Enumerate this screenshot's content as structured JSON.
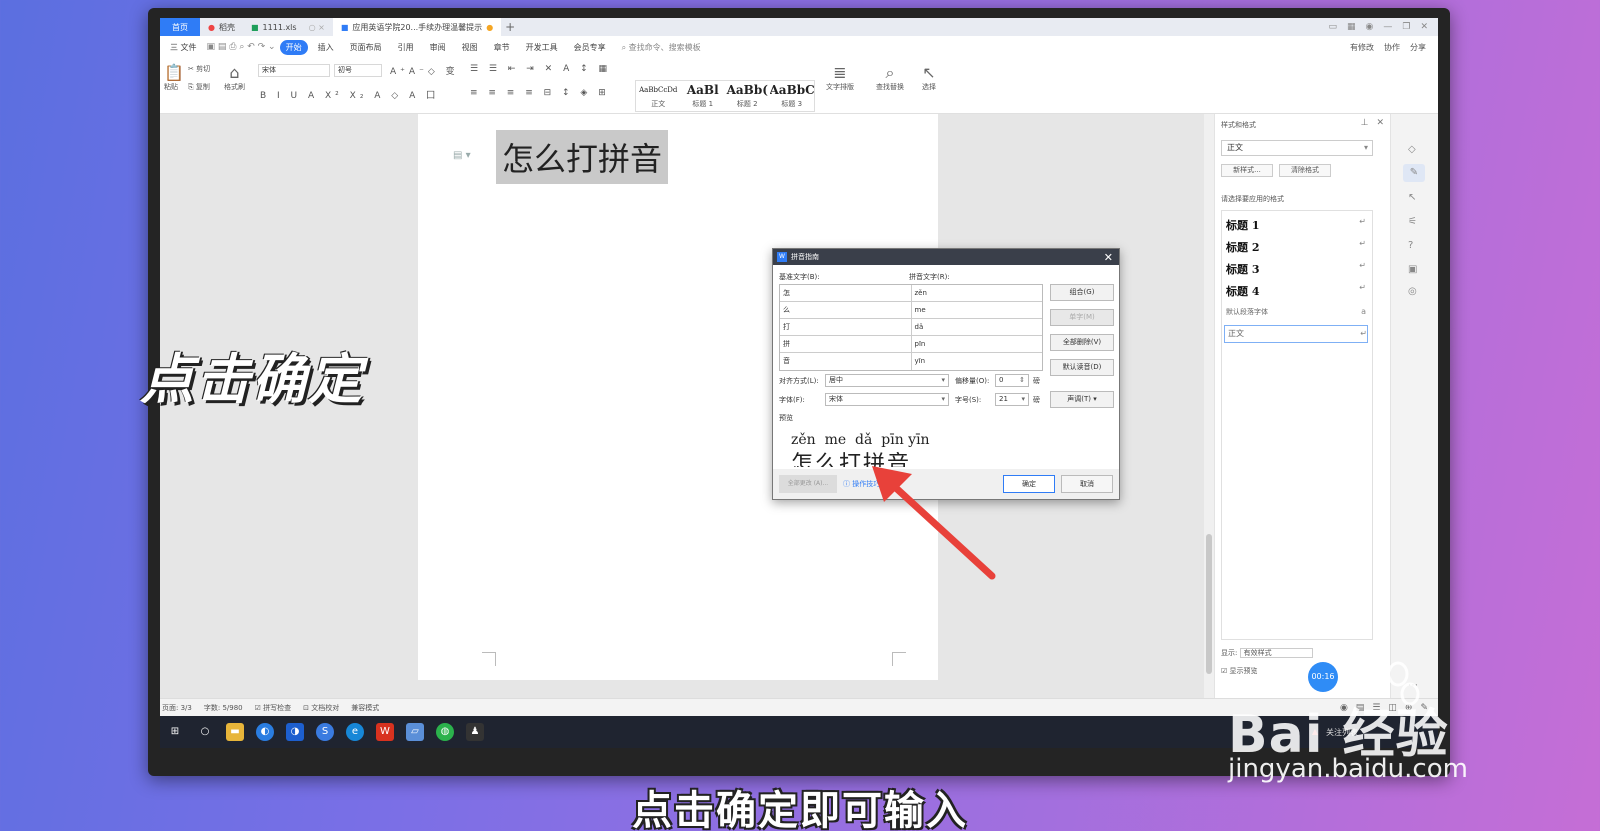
{
  "tabs": [
    {
      "label": "首页",
      "kind": "home"
    },
    {
      "label": "稻壳",
      "kind": "normal"
    },
    {
      "label": "1111.xls",
      "kind": "normal"
    },
    {
      "label": "应用英语学院20...手续办理温馨提示",
      "kind": "active"
    }
  ],
  "tab_plus": "+",
  "menu": {
    "file": "三 文件",
    "items": [
      "开始",
      "插入",
      "页面布局",
      "引用",
      "审阅",
      "视图",
      "章节",
      "开发工具",
      "会员专享"
    ],
    "active": "开始",
    "search": "查找命令、搜索模板",
    "right": [
      "有修改",
      "协作",
      "分享"
    ]
  },
  "ribbon": {
    "paste": "粘贴",
    "cut": "剪切",
    "copy": "复制",
    "format_painter": "格式刷",
    "font_name": "宋体",
    "font_size": "初号",
    "styles": [
      {
        "sample": "AaBbCcDd",
        "label": "正文"
      },
      {
        "sample": "AaBl",
        "label": "标题 1"
      },
      {
        "sample": "AaBb(",
        "label": "标题 2"
      },
      {
        "sample": "AaBbC",
        "label": "标题 3"
      }
    ],
    "text_layout": "文字排版",
    "find_replace": "查找替换",
    "select": "选择"
  },
  "document": {
    "heading": "怎么打拼音"
  },
  "dialog": {
    "title": "拼音指南",
    "col_base": "基准文字(B):",
    "col_pinyin": "拼音文字(R):",
    "rows": [
      {
        "base": "怎",
        "pinyin": "zěn"
      },
      {
        "base": "么",
        "pinyin": "me"
      },
      {
        "base": "打",
        "pinyin": "dǎ"
      },
      {
        "base": "拼",
        "pinyin": "pīn"
      },
      {
        "base": "音",
        "pinyin": "yīn"
      }
    ],
    "btn_combine": "组合(G)",
    "btn_single": "单字(M)",
    "btn_clear_all": "全部删除(V)",
    "btn_default": "默认读音(D)",
    "align_label": "对齐方式(L):",
    "align_value": "居中",
    "offset_label": "偏移量(O):",
    "offset_value": "0",
    "offset_unit": "磅",
    "font_label": "字体(F):",
    "font_value": "宋体",
    "size_label": "字号(S):",
    "size_value": "21",
    "size_unit": "磅",
    "tone_btn": "声调(T)",
    "preview_label": "预览",
    "preview_pinyin": "zěn  me  dǎ  pīn yīn",
    "preview_chars": "怎么打拼音",
    "apply_all": "全部更改 (A)...",
    "tips": "操作技巧",
    "ok": "确定",
    "cancel": "取消"
  },
  "panel": {
    "title": "样式和格式",
    "current_style": "正文",
    "new_style": "新样式...",
    "clear_format": "清除格式",
    "apply_label": "请选择要应用的格式",
    "styles": [
      "标题 1",
      "标题 2",
      "标题 3",
      "标题 4"
    ],
    "default_font": "默认段落字体",
    "selected": "正文",
    "show_label": "显示:",
    "show_value": "有效样式",
    "show_preview": "显示预览"
  },
  "statusbar": {
    "page": "页面: 3/3",
    "words": "字数: 5/980",
    "spell": "拼写检查",
    "proof": "文档校对",
    "compat": "兼容模式"
  },
  "taskbar": {
    "tray_text": "关注列表"
  },
  "overlay": {
    "caption": "点击确定",
    "subtitle": "点击确定即可输入",
    "watermark": "Bai 经验",
    "watermark_url": "jingyan.baidu.com",
    "timer": "00:16",
    "arrow_color": "#e8413a"
  }
}
